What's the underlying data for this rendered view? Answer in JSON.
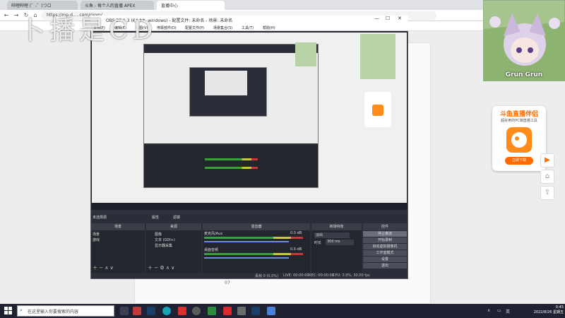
{
  "browser": {
    "tabs": [
      {
        "label": "哔哩哔哩 (゜-゜)つロ"
      },
      {
        "label": "斗鱼 - 每个人的直播 APEX"
      },
      {
        "label": "直播中心"
      }
    ],
    "address": "https://mp.d.....com/room/...",
    "page_number": "07"
  },
  "watermark": "卜播是CD",
  "anime_overlay": {
    "label": "Grun Grun"
  },
  "promo": {
    "title": "斗鱼直播伴侣",
    "subtitle": "超好用的PC端直播工具",
    "download_label": "立即下载"
  },
  "obs": {
    "title": "OBS 27.1.3 (64-bit, windows) - 配置文件: 未命名 - 场景: 未命名",
    "menu": [
      "文件(F)",
      "编辑(E)",
      "视图(V)",
      "停靠部件(D)",
      "配置文件(P)",
      "场景集合(S)",
      "工具(T)",
      "帮助(H)"
    ],
    "no_source_label": "未选择源",
    "properties_label": "属性",
    "filters_label": "滤镜",
    "docks": {
      "scenes": {
        "header": "场景",
        "items": [
          "场景",
          "游戏"
        ]
      },
      "sources": {
        "header": "来源",
        "items": [
          "图像",
          "文本 (GDI+)",
          "显示器采集"
        ]
      },
      "mixer": {
        "header": "混音器",
        "tracks": [
          {
            "name": "麦克风/Aux",
            "level": "0.0 dB"
          },
          {
            "name": "桌面音频",
            "level": "0.0 dB"
          }
        ]
      },
      "transitions": {
        "header": "转场特效",
        "type": "淡出",
        "duration_label": "时长",
        "duration": "300 ms"
      },
      "controls": {
        "header": "控件",
        "buttons": [
          "停止推流",
          "开始录制",
          "启动虚拟摄像机",
          "工作室模式",
          "设置",
          "退出"
        ]
      }
    },
    "status": {
      "dropped": "丢帧 0 (0.0%)",
      "live": "LIVE: 00:00:00",
      "rec": "REC: 00:00:00",
      "cpu": "CPU: 3.9%, 30.00 fps"
    }
  },
  "taskbar": {
    "search_placeholder": "在这里输入你要搜索的内容",
    "tray_lang": "英",
    "time": "0:45",
    "date": "2022/8/26 星期五"
  }
}
